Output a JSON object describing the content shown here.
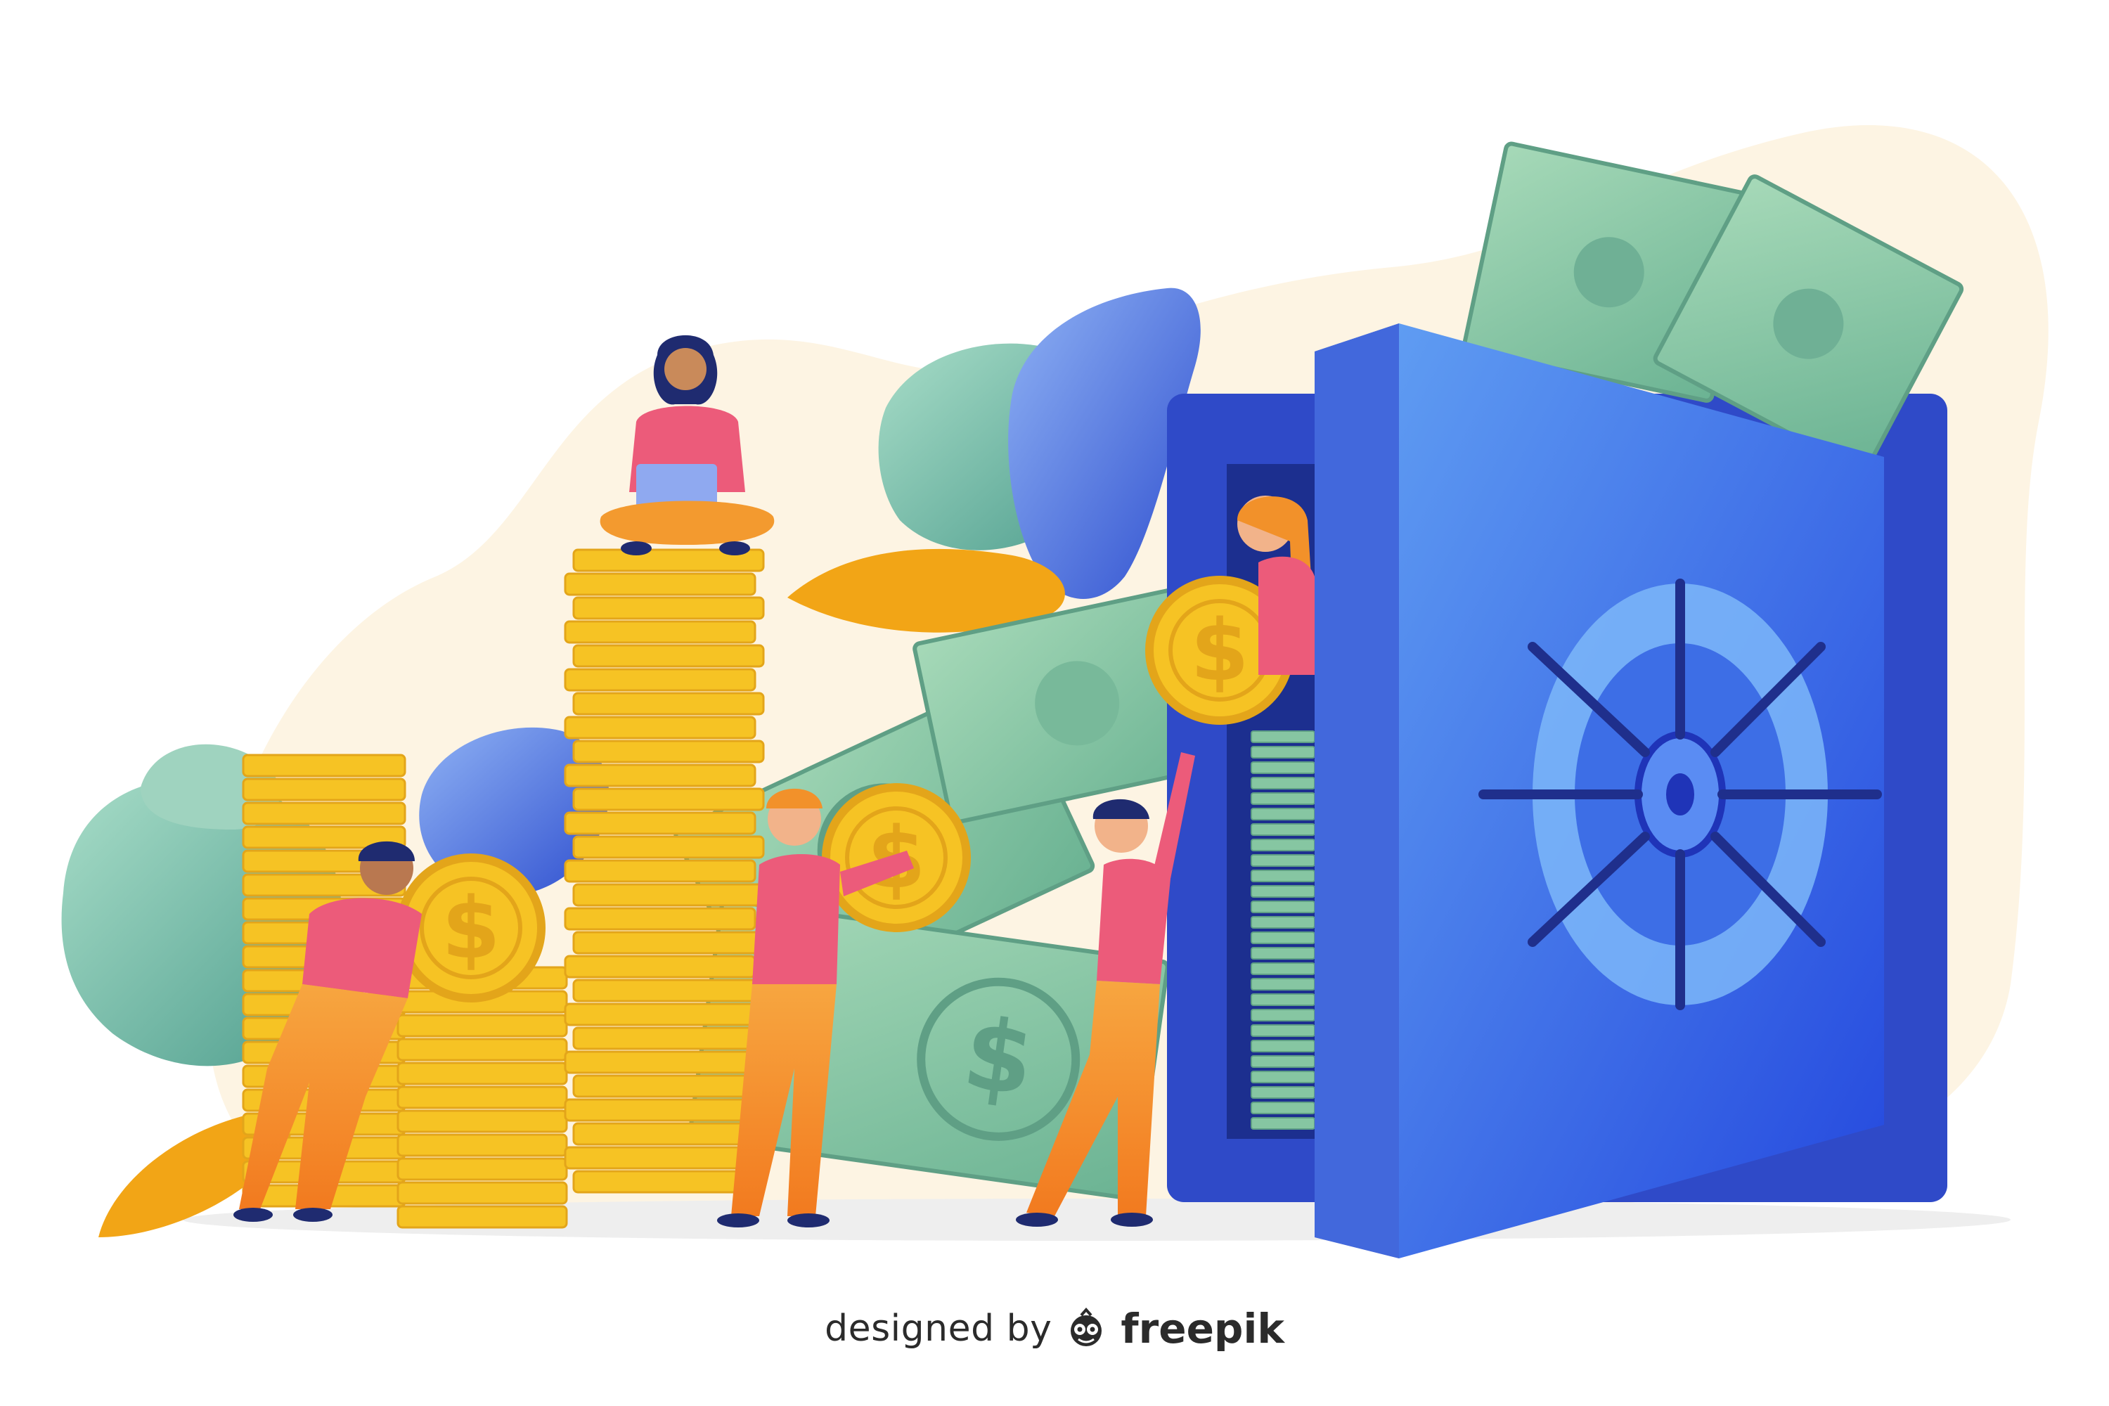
{
  "credit": {
    "designed_by": "designed by",
    "brand": "freepik",
    "brand_icon": "freepik-logo-icon"
  },
  "coins": {
    "symbol": "$"
  },
  "banknotes": {
    "symbol": "$"
  },
  "colors": {
    "background": "#ffffff",
    "blob": "#fdf4e3",
    "coin": "#f6c324",
    "coin_dark": "#e3a51a",
    "bill": "#86c6a2",
    "bill_dark": "#5f9f85",
    "safe": "#2d4fd6",
    "safe_light": "#5b8df0",
    "leaf_green": "#7cc3a8",
    "leaf_blue": "#3f63d8",
    "leaf_orange": "#f2a516",
    "shirt": "#ec5b7a",
    "pants": "#f3902a"
  }
}
